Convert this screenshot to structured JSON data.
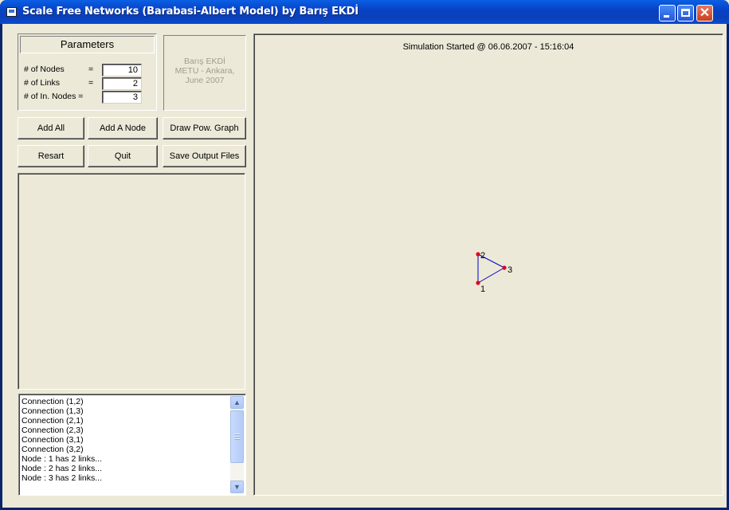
{
  "window": {
    "title": "Scale Free Networks (Barabasi-Albert Model) by Barış EKDİ",
    "close_glyph": "✕"
  },
  "parameters": {
    "header": "Parameters",
    "fields": [
      {
        "label": "# of Nodes",
        "equals": "=",
        "value": "10"
      },
      {
        "label": "# of Links",
        "equals": "=",
        "value": "2"
      },
      {
        "label": "# of In. Nodes =",
        "equals": "",
        "value": "3"
      }
    ]
  },
  "credit": {
    "line1": "Barış EKDİ",
    "line2": "METU - Ankara,",
    "line3": "June 2007"
  },
  "buttons": {
    "add_all": "Add All",
    "add_node": "Add A Node",
    "draw_pow_graph": "Draw Pow. Graph",
    "restart": "Resart",
    "quit": "Quit",
    "save_output": "Save Output Files"
  },
  "log": {
    "lines": [
      "Connection (1,2)",
      "Connection (1,3)",
      "Connection (2,1)",
      "Connection (2,3)",
      "Connection (3,1)",
      "Connection (3,2)",
      "Node : 1 has 2 links...",
      "Node : 2 has 2 links...",
      "Node : 3 has 2 links..."
    ],
    "scroll_up": "▲",
    "scroll_down": "▼"
  },
  "simulation": {
    "status": "Simulation Started @ 06.06.2007 - 15:16:04"
  },
  "graph": {
    "nodes": [
      {
        "id": "1",
        "label": "1"
      },
      {
        "id": "2",
        "label": "2"
      },
      {
        "id": "3",
        "label": "3"
      }
    ],
    "edges": [
      [
        "1",
        "2"
      ],
      [
        "1",
        "3"
      ],
      [
        "2",
        "3"
      ]
    ],
    "node_color": "#e0001b",
    "edge_color": "#0000cc"
  }
}
